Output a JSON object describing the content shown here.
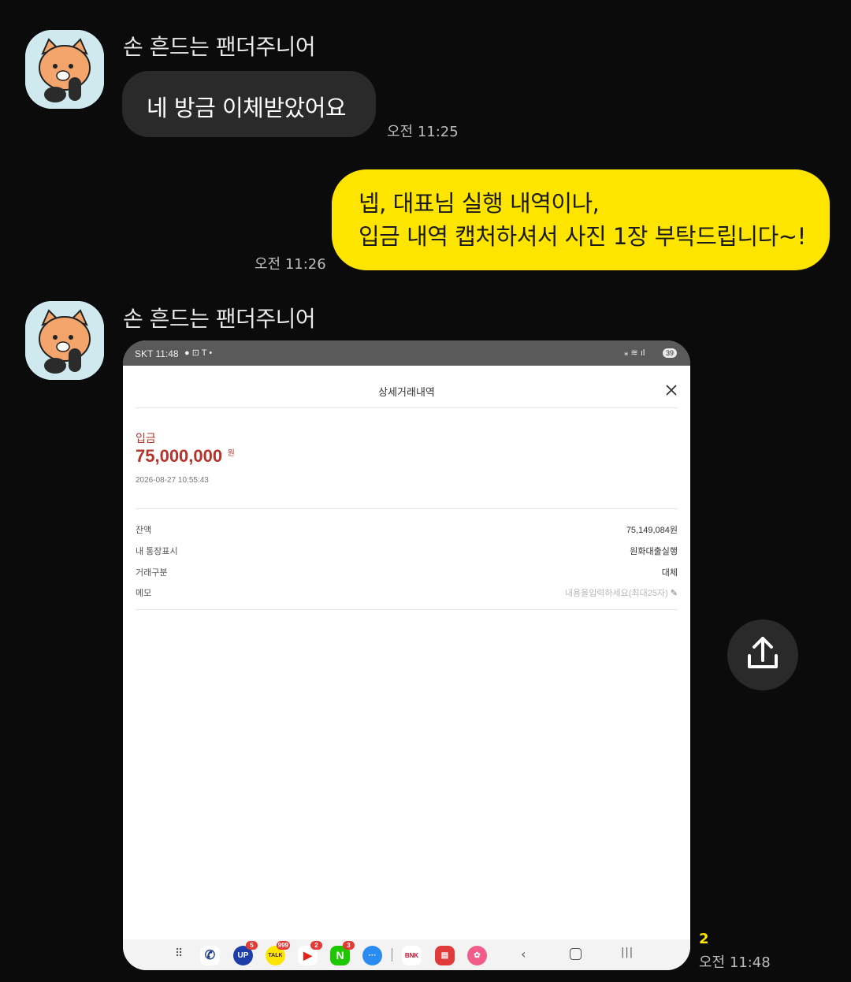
{
  "messages": [
    {
      "sender": "손 흔드는 팬더주니어",
      "text": "네 방금 이체받았어요",
      "time": "오전 11:25"
    },
    {
      "line1": "넵, 대표님 실행 내역이나,",
      "line2": "입금 내역 캡처하셔서 사진 1장 부탁드립니다~!",
      "time": "오전 11:26"
    },
    {
      "sender": "손 흔드는 팬더주니어",
      "unread": "2",
      "time": "오전 11:48"
    }
  ],
  "screenshot": {
    "status_left": "SKT 11:48",
    "battery": "39",
    "title": "상세거래내역",
    "type_label": "입금",
    "amount": "75,000,000",
    "amount_unit": "원",
    "datetime": "2026-08-27 10:55:43",
    "rows": [
      {
        "label": "잔액",
        "value": "75,149,084원"
      },
      {
        "label": "내 통장표시",
        "value": "원화대출실행"
      },
      {
        "label": "거래구분",
        "value": "대체"
      },
      {
        "label": "메모",
        "value": "내용을입력하세요(최대25자)"
      }
    ],
    "dock_badges": [
      "5",
      "999",
      "2",
      "3"
    ],
    "dock_labels": [
      "UP",
      "TALK",
      "N",
      "BNK"
    ]
  },
  "icons": [
    "share-icon",
    "close-icon",
    "pencil-icon"
  ],
  "colors": {
    "out_bubble": "#fee500",
    "in_bubble": "#2a2a2a",
    "amount": "#b5332b"
  }
}
